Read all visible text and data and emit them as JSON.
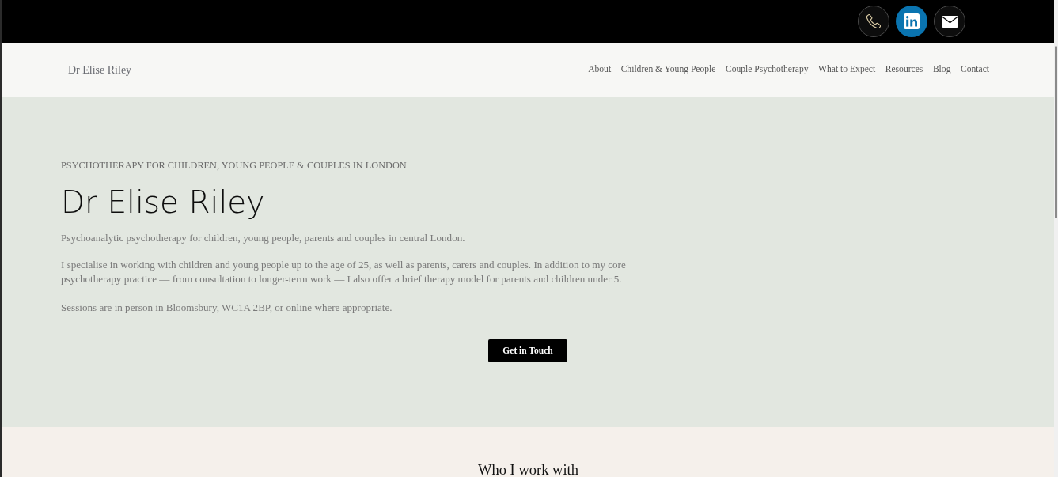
{
  "top_bar": {
    "icons": [
      {
        "kind": "phone"
      },
      {
        "kind": "linkedin"
      },
      {
        "kind": "email"
      }
    ]
  },
  "navbar": {
    "brand": "Dr Elise Riley",
    "links": [
      "About",
      "Children & Young People",
      "Couple Psychotherapy",
      "What to Expect",
      "Resources",
      "Blog",
      "Contact"
    ]
  },
  "hero": {
    "eyebrow": "PSYCHOTHERAPY FOR CHILDREN, YOUNG PEOPLE & COUPLES IN LONDON",
    "title": "Dr Elise Riley",
    "paragraphs": [
      "Psychoanalytic psychotherapy for children, young people, parents and couples in central London.",
      "I specialise in working with children and young people up to the age of 25, as well as parents, carers and couples. In addition to my core psychotherapy practice — from consultation to longer-term work — I also offer a brief therapy model for parents and children under 5.",
      "Sessions are in person in Bloomsbury, WC1A 2BP, or online where appropriate."
    ],
    "button": "Get in Touch"
  },
  "next_section": {
    "heading": "Who I work with"
  }
}
